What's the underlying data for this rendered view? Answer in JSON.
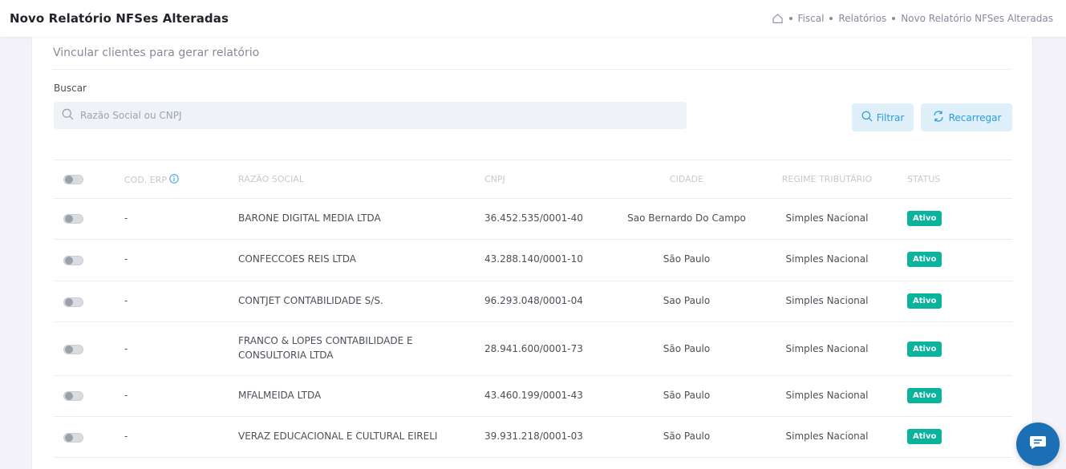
{
  "header": {
    "title": "Novo Relatório NFSes Alteradas",
    "breadcrumb": [
      "Fiscal",
      "Relatórios",
      "Novo Relatório NFSes Alteradas"
    ]
  },
  "card": {
    "title": "Vincular clientes para gerar relatório"
  },
  "search": {
    "label": "Buscar",
    "placeholder": "Razão Social ou CNPJ",
    "value": ""
  },
  "buttons": {
    "filter": "Filtrar",
    "reload": "Recarregar"
  },
  "table": {
    "columns": [
      "COD. ERP",
      "RAZÃO SOCIAL",
      "CNPJ",
      "CIDADE",
      "REGIME TRIBUTÁRIO",
      "STATUS"
    ],
    "rows": [
      {
        "cod": "-",
        "razao": "BARONE DIGITAL MEDIA LTDA",
        "razao2": "",
        "cnpj": "36.452.535/0001-40",
        "cidade": "Sao Bernardo Do Campo",
        "regime": "Simples Nacional",
        "status": "Ativo"
      },
      {
        "cod": "-",
        "razao": "CONFECCOES REIS LTDA",
        "razao2": "",
        "cnpj": "43.288.140/0001-10",
        "cidade": "São Paulo",
        "regime": "Simples Nacional",
        "status": "Ativo"
      },
      {
        "cod": "-",
        "razao": "CONTJET CONTABILIDADE S/S.",
        "razao2": "",
        "cnpj": "96.293.048/0001-04",
        "cidade": "Sao Paulo",
        "regime": "Simples Nacional",
        "status": "Ativo"
      },
      {
        "cod": "-",
        "razao": "FRANCO & LOPES CONTABILIDADE E",
        "razao2": "CONSULTORIA LTDA",
        "cnpj": "28.941.600/0001-73",
        "cidade": "São Paulo",
        "regime": "Simples Nacional",
        "status": "Ativo"
      },
      {
        "cod": "-",
        "razao": "MFALMEIDA LTDA",
        "razao2": "",
        "cnpj": "43.460.199/0001-43",
        "cidade": "São Paulo",
        "regime": "Simples Nacional",
        "status": "Ativo"
      },
      {
        "cod": "-",
        "razao": "VERAZ EDUCACIONAL E CULTURAL EIRELI",
        "razao2": "",
        "cnpj": "39.931.218/0001-03",
        "cidade": "São Paulo",
        "regime": "Simples Nacional",
        "status": "Ativo"
      }
    ]
  },
  "colors": {
    "accent": "#299cdb",
    "status_active": "#0ab39c",
    "chat": "#1a6fb5"
  },
  "icons": {
    "home": "home-icon",
    "search": "search-icon",
    "refresh": "refresh-icon",
    "info": "info-icon",
    "chat": "chat-icon"
  }
}
